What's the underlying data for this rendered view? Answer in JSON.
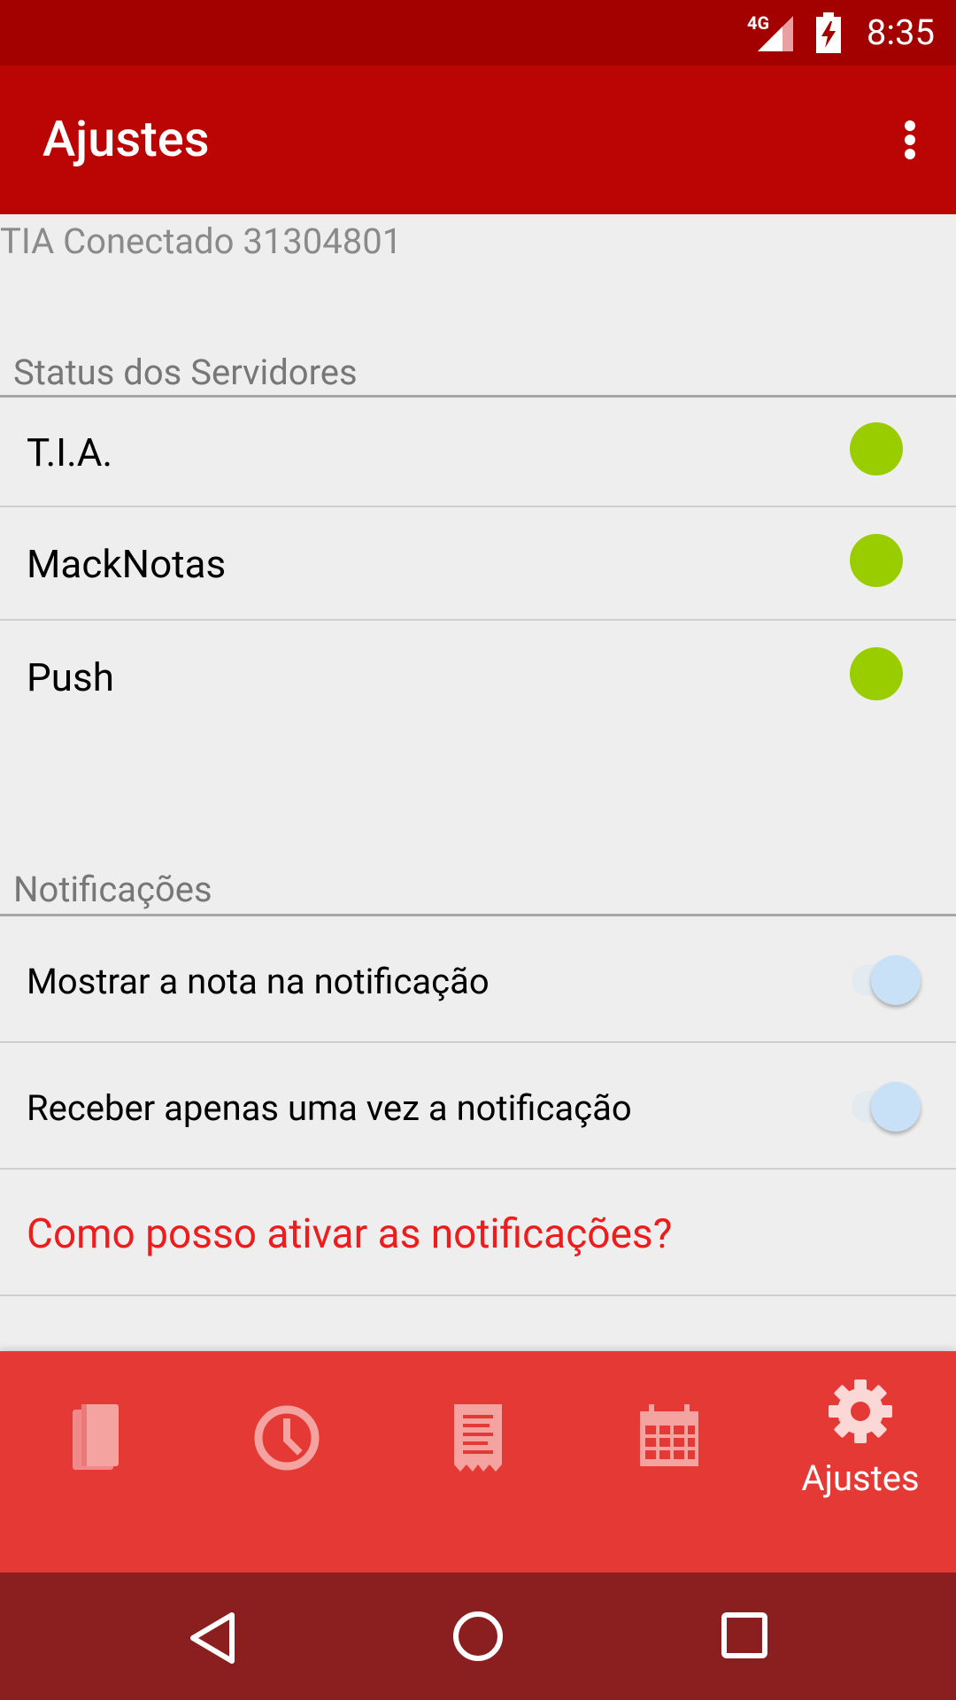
{
  "status_bar": {
    "network": "4G",
    "time": "8:35"
  },
  "app_bar": {
    "title": "Ajustes"
  },
  "connection_text": "TIA Conectado 31304801",
  "server_status": {
    "header": "Status dos Servidores",
    "items": [
      {
        "label": "T.I.A.",
        "status_color": "#9acd00"
      },
      {
        "label": "MackNotas",
        "status_color": "#9acd00"
      },
      {
        "label": "Push",
        "status_color": "#9acd00"
      }
    ]
  },
  "notifications": {
    "header": "Notificações",
    "toggles": [
      {
        "label": "Mostrar a nota na notificação",
        "enabled": true
      },
      {
        "label": "Receber apenas uma vez a notificação",
        "enabled": true
      }
    ],
    "help_link": "Como posso ativar as notificações?"
  },
  "bottom_nav": {
    "items": [
      {
        "icon": "book-icon",
        "label": ""
      },
      {
        "icon": "clock-icon",
        "label": ""
      },
      {
        "icon": "receipt-icon",
        "label": ""
      },
      {
        "icon": "calendar-icon",
        "label": ""
      },
      {
        "icon": "gear-icon",
        "label": "Ajustes",
        "active": true
      }
    ]
  },
  "colors": {
    "status_bar": "#a30000",
    "app_bar": "#bb0505",
    "bottom_nav": "#e53935",
    "system_nav": "#8b1f1f",
    "status_ok": "#9acd00",
    "link": "#ee1c1c"
  }
}
